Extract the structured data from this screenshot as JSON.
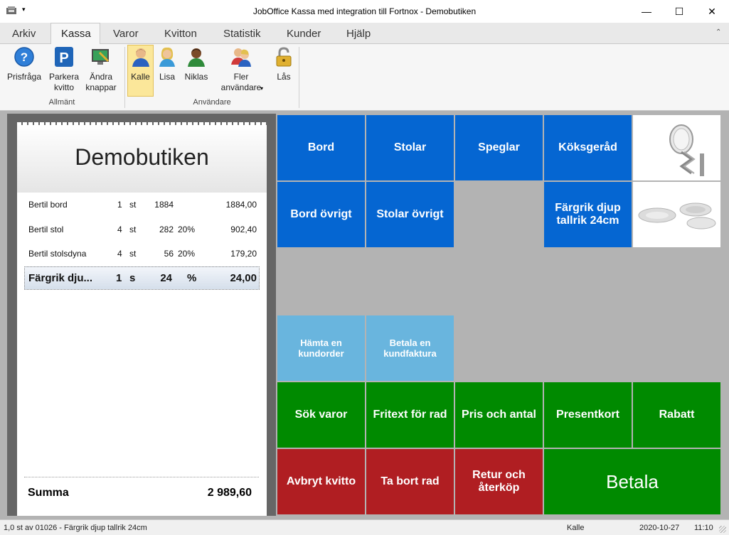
{
  "window": {
    "title": "JobOffice Kassa med integration till Fortnox - Demobutiken",
    "minimize": "—",
    "maximize": "☐",
    "close": "✕"
  },
  "tabs": [
    "Arkiv",
    "Kassa",
    "Varor",
    "Kvitton",
    "Statistik",
    "Kunder",
    "Hjälp"
  ],
  "active_tab": "Kassa",
  "ribbon": {
    "groups": [
      {
        "label": "Allmänt",
        "buttons": [
          {
            "label": "Prisfråga",
            "icon": "help-icon"
          },
          {
            "label": "Parkera kvitto",
            "icon": "parking-icon"
          },
          {
            "label": "Ändra knappar",
            "icon": "edit-buttons-icon"
          }
        ]
      },
      {
        "label": "Användare",
        "buttons": [
          {
            "label": "Kalle",
            "icon": "user-icon",
            "selected": true
          },
          {
            "label": "Lisa",
            "icon": "user-icon"
          },
          {
            "label": "Niklas",
            "icon": "user-icon"
          },
          {
            "label": "Fler användare",
            "icon": "users-icon"
          },
          {
            "label": "Lås",
            "icon": "lock-icon"
          }
        ]
      }
    ]
  },
  "receipt": {
    "store_name": "Demobutiken",
    "rows": [
      {
        "name": "Bertil bord",
        "qty": "1",
        "unit": "st",
        "price": "1884",
        "discount": "",
        "total": "1884,00"
      },
      {
        "name": "Bertil stol",
        "qty": "4",
        "unit": "st",
        "price": "282",
        "discount": "20%",
        "total": "902,40"
      },
      {
        "name": "Bertil stolsdyna",
        "qty": "4",
        "unit": "st",
        "price": "56",
        "discount": "20%",
        "total": "179,20"
      },
      {
        "name": "Färgrik dju...",
        "qty": "1",
        "unit": "s",
        "price": "24",
        "discount": "%",
        "total": "24,00"
      }
    ],
    "sum_label": "Summa",
    "sum_value": "2 989,60"
  },
  "tiles": {
    "bord": "Bord",
    "stolar": "Stolar",
    "speglar": "Speglar",
    "koksgerad": "Köksgeråd",
    "bord_ovrigt": "Bord övrigt",
    "stolar_ovrigt": "Stolar övrigt",
    "fargrik": "Färgrik djup tallrik 24cm",
    "hamta": "Hämta en kundorder",
    "betala_faktura": "Betala en kundfaktura",
    "sok_varor": "Sök varor",
    "fritext": "Fritext för rad",
    "pris_antal": "Pris och antal",
    "presentkort": "Presentkort",
    "rabatt": "Rabatt",
    "avbryt": "Avbryt kvitto",
    "ta_bort": "Ta bort rad",
    "retur": "Retur och återköp",
    "betala": "Betala"
  },
  "colors": {
    "blue": "#0566d2",
    "light_blue": "#69b5de",
    "green": "#008a00",
    "red": "#b01e22"
  },
  "status": {
    "left": "1,0 st av 01026 - Färgrik djup tallrik 24cm",
    "user": "Kalle",
    "date": "2020-10-27",
    "time": "11:10"
  }
}
